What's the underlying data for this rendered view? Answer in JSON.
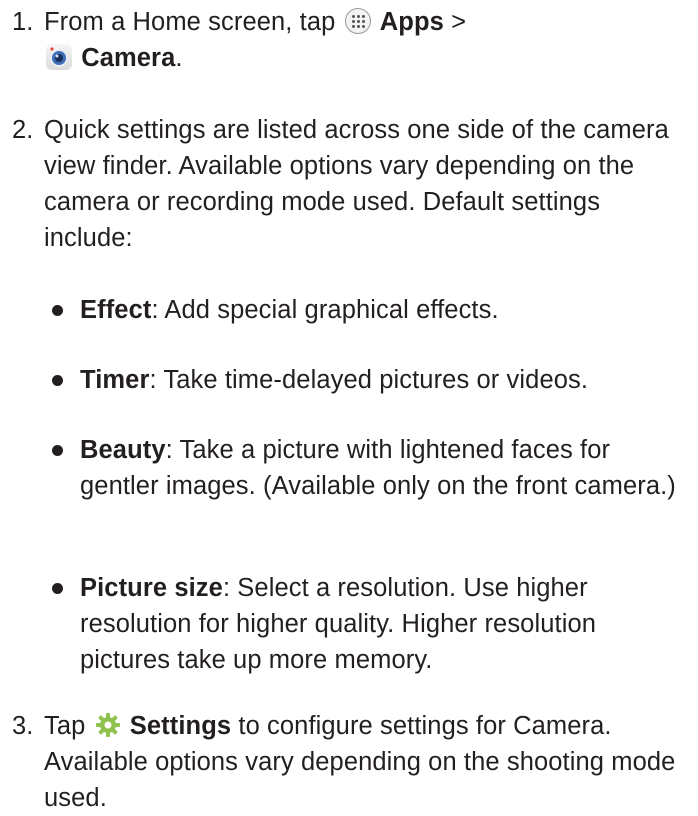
{
  "steps": [
    {
      "number": "1.",
      "line1_text": "From a Home screen, tap",
      "apps_label": "Apps",
      "gt": " >",
      "camera_label": "Camera",
      "period": "."
    },
    {
      "number": "2.",
      "text": "Quick settings are listed across one side of the camera view finder. Available options vary depending on the camera or recording mode used. Default settings include:",
      "bullets": [
        {
          "term": "Effect",
          "desc": ": Add special graphical effects."
        },
        {
          "term": "Timer",
          "desc": ": Take time-delayed pictures or videos."
        },
        {
          "term": "Beauty",
          "desc": ": Take a picture with lightened faces for gentler images. (Available only on the front camera.)"
        },
        {
          "term": "Picture size",
          "desc": ": Select a resolution. Use higher resolution for higher quality. Higher resolution pictures take up more memory."
        }
      ]
    },
    {
      "number": "3.",
      "tap": "Tap",
      "settings_label": "Settings",
      "rest": " to configure settings for Camera. Available options vary depending on the shooting mode used."
    }
  ],
  "icons": {
    "apps": "apps-icon",
    "camera": "camera-icon",
    "settings": "gear-icon"
  }
}
